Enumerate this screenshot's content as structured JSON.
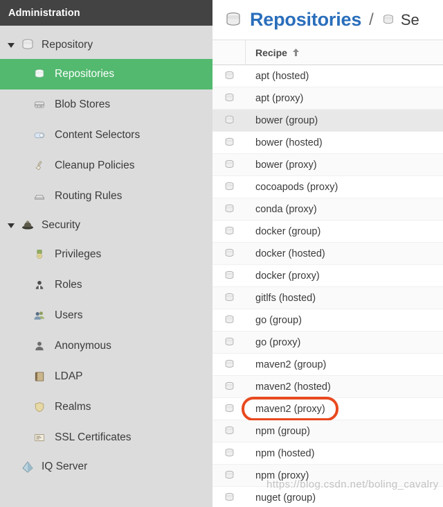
{
  "sidebar": {
    "header_title": "Administration",
    "groups": [
      {
        "label": "Repository",
        "icon": "database-icon",
        "expanded": true,
        "items": [
          {
            "label": "Repositories",
            "icon": "database-icon",
            "selected": true
          },
          {
            "label": "Blob Stores",
            "icon": "blob-store-icon",
            "selected": false
          },
          {
            "label": "Content Selectors",
            "icon": "content-selector-icon",
            "selected": false
          },
          {
            "label": "Cleanup Policies",
            "icon": "broom-icon",
            "selected": false
          },
          {
            "label": "Routing Rules",
            "icon": "routing-rules-icon",
            "selected": false
          }
        ]
      },
      {
        "label": "Security",
        "icon": "security-bell-icon",
        "expanded": true,
        "items": [
          {
            "label": "Privileges",
            "icon": "medal-icon",
            "selected": false
          },
          {
            "label": "Roles",
            "icon": "role-person-icon",
            "selected": false
          },
          {
            "label": "Users",
            "icon": "users-icon",
            "selected": false
          },
          {
            "label": "Anonymous",
            "icon": "anonymous-person-icon",
            "selected": false
          },
          {
            "label": "LDAP",
            "icon": "ldap-book-icon",
            "selected": false
          },
          {
            "label": "Realms",
            "icon": "shield-icon",
            "selected": false
          },
          {
            "label": "SSL Certificates",
            "icon": "certificate-icon",
            "selected": false
          }
        ]
      }
    ],
    "footer_item": {
      "label": "IQ Server",
      "icon": "iq-server-icon"
    }
  },
  "main": {
    "breadcrumb": {
      "primary": "Repositories",
      "separator": "/",
      "secondary": "Se",
      "primary_icon": "database-icon",
      "secondary_icon": "database-icon",
      "primary_color": "#2a6ebb"
    },
    "table": {
      "columns": [
        {
          "label": "Recipe",
          "sort": "asc",
          "sort_glyph": "arrow-up-icon"
        }
      ],
      "row_icon": "database-icon",
      "rows": [
        {
          "name": "apt (hosted)",
          "state": "normal"
        },
        {
          "name": "apt (proxy)",
          "state": "alt"
        },
        {
          "name": "bower (group)",
          "state": "hover"
        },
        {
          "name": "bower (hosted)",
          "state": "normal"
        },
        {
          "name": "bower (proxy)",
          "state": "alt"
        },
        {
          "name": "cocoapods (proxy)",
          "state": "normal"
        },
        {
          "name": "conda (proxy)",
          "state": "alt"
        },
        {
          "name": "docker (group)",
          "state": "normal"
        },
        {
          "name": "docker (hosted)",
          "state": "alt"
        },
        {
          "name": "docker (proxy)",
          "state": "normal"
        },
        {
          "name": "gitlfs (hosted)",
          "state": "alt"
        },
        {
          "name": "go (group)",
          "state": "normal"
        },
        {
          "name": "go (proxy)",
          "state": "alt"
        },
        {
          "name": "maven2 (group)",
          "state": "normal"
        },
        {
          "name": "maven2 (hosted)",
          "state": "alt"
        },
        {
          "name": "maven2 (proxy)",
          "state": "normal",
          "annotated": true
        },
        {
          "name": "npm (group)",
          "state": "alt"
        },
        {
          "name": "npm (hosted)",
          "state": "normal"
        },
        {
          "name": "npm (proxy)",
          "state": "alt"
        },
        {
          "name": "nuget (group)",
          "state": "normal"
        }
      ]
    },
    "annotation_color": "#e8491f",
    "watermark": "https://blog.csdn.net/boling_cavalry"
  }
}
